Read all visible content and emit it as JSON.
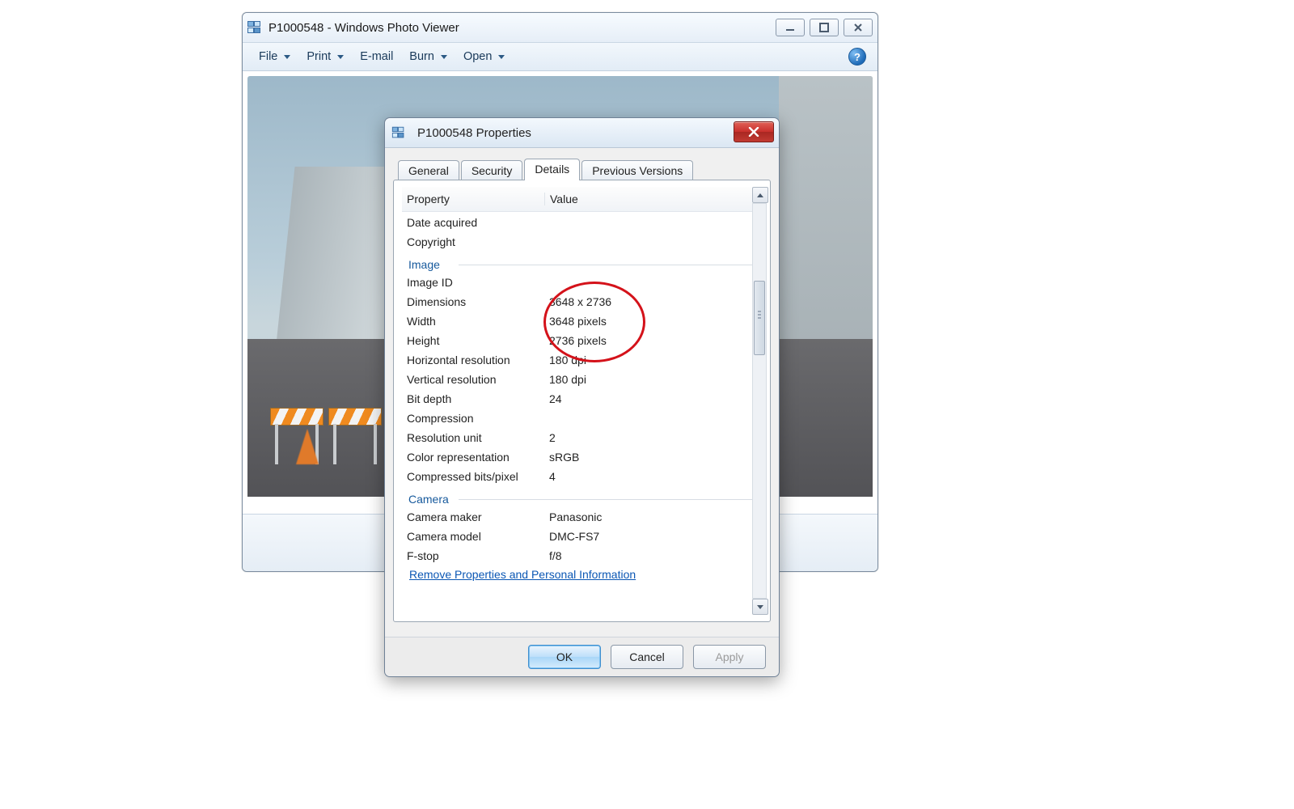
{
  "photoViewer": {
    "title": "P1000548 - Windows Photo Viewer",
    "menu": {
      "file": "File",
      "print": "Print",
      "email": "E-mail",
      "burn": "Burn",
      "open": "Open"
    }
  },
  "dialog": {
    "title": "P1000548 Properties",
    "tabs": {
      "general": "General",
      "security": "Security",
      "details": "Details",
      "previous": "Previous Versions"
    },
    "columns": {
      "property": "Property",
      "value": "Value"
    },
    "sections": {
      "image": "Image",
      "camera": "Camera"
    },
    "rows": {
      "dateAcquired": {
        "p": "Date acquired",
        "v": ""
      },
      "copyright": {
        "p": "Copyright",
        "v": ""
      },
      "imageId": {
        "p": "Image ID",
        "v": ""
      },
      "dimensions": {
        "p": "Dimensions",
        "v": "3648 x 2736"
      },
      "width": {
        "p": "Width",
        "v": "3648 pixels"
      },
      "height": {
        "p": "Height",
        "v": "2736 pixels"
      },
      "hres": {
        "p": "Horizontal resolution",
        "v": "180 dpi"
      },
      "vres": {
        "p": "Vertical resolution",
        "v": "180 dpi"
      },
      "bitDepth": {
        "p": "Bit depth",
        "v": "24"
      },
      "compression": {
        "p": "Compression",
        "v": ""
      },
      "resUnit": {
        "p": "Resolution unit",
        "v": "2"
      },
      "colorRep": {
        "p": "Color representation",
        "v": "sRGB"
      },
      "compBpp": {
        "p": "Compressed bits/pixel",
        "v": "4"
      },
      "camMaker": {
        "p": "Camera maker",
        "v": "Panasonic"
      },
      "camModel": {
        "p": "Camera model",
        "v": "DMC-FS7"
      },
      "fstop": {
        "p": "F-stop",
        "v": "f/8"
      }
    },
    "removeLink": "Remove Properties and Personal Information",
    "buttons": {
      "ok": "OK",
      "cancel": "Cancel",
      "apply": "Apply"
    }
  }
}
